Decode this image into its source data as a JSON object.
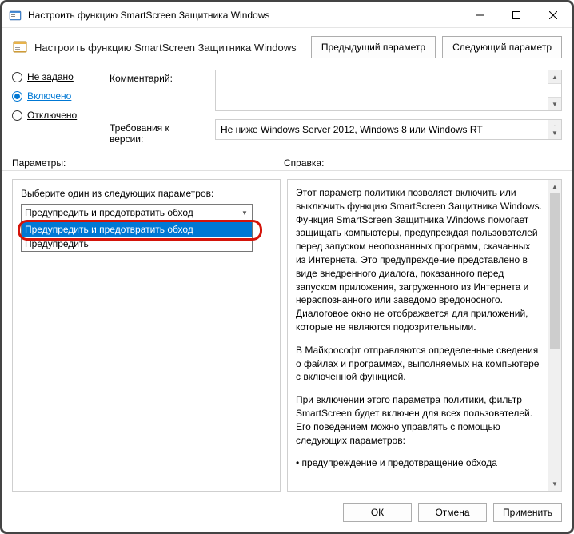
{
  "window": {
    "title": "Настроить функцию SmartScreen Защитника Windows"
  },
  "header": {
    "title": "Настроить функцию SmartScreen Защитника Windows",
    "prev_button": "Предыдущий параметр",
    "next_button": "Следующий параметр"
  },
  "state": {
    "options": [
      "Не задано",
      "Включено",
      "Отключено"
    ],
    "selected_index": 1
  },
  "comment": {
    "label": "Комментарий:",
    "value": ""
  },
  "requirements": {
    "label": "Требования к версии:",
    "value": "Не ниже Windows Server 2012, Windows 8 или Windows RT"
  },
  "sections": {
    "options_label": "Параметры:",
    "help_label": "Справка:"
  },
  "options_pane": {
    "prompt": "Выберите один из следующих параметров:",
    "combo_value": "Предупредить и предотвратить обход",
    "dropdown": {
      "items": [
        "Предупредить и предотвратить обход",
        "Предупредить"
      ],
      "selected_index": 0
    }
  },
  "help_pane": {
    "p1": "Этот параметр политики позволяет включить или выключить функцию SmartScreen Защитника Windows. Функция SmartScreen Защитника Windows помогает защищать компьютеры, предупреждая пользователей перед запуском неопознанных программ, скачанных из Интернета. Это предупреждение представлено в виде внедренного диалога, показанного перед запуском приложения, загруженного из Интернета и нераспознанного или заведомо вредоносного. Диалоговое окно не отображается для приложений, которые не являются подозрительными.",
    "p2": "В Майкрософт отправляются определенные сведения о файлах и программах, выполняемых на компьютере с включенной функцией.",
    "p3": "При включении этого параметра политики, фильтр SmartScreen будет включен для всех пользователей. Его поведением можно управлять с помощью следующих параметров:",
    "p4": "• предупреждение и предотвращение обхода"
  },
  "buttons": {
    "ok": "ОК",
    "cancel": "Отмена",
    "apply": "Применить"
  }
}
